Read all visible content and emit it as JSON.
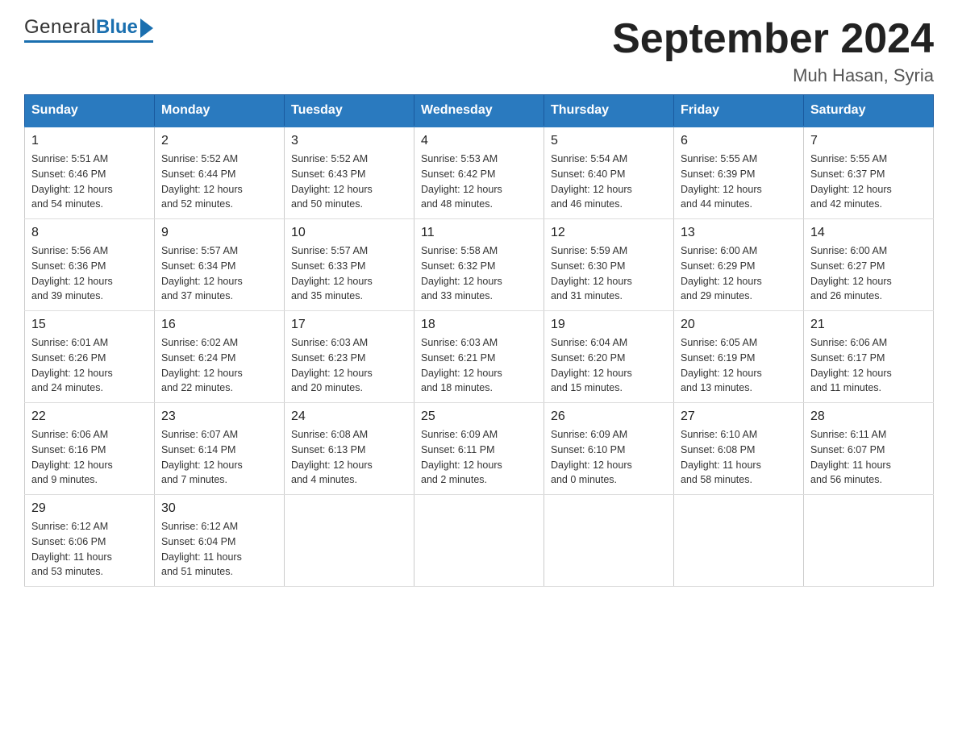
{
  "header": {
    "logo_general": "General",
    "logo_blue": "Blue",
    "month_title": "September 2024",
    "location": "Muh Hasan, Syria"
  },
  "days_of_week": [
    "Sunday",
    "Monday",
    "Tuesday",
    "Wednesday",
    "Thursday",
    "Friday",
    "Saturday"
  ],
  "weeks": [
    [
      {
        "day": "1",
        "sunrise": "5:51 AM",
        "sunset": "6:46 PM",
        "daylight": "12 hours and 54 minutes."
      },
      {
        "day": "2",
        "sunrise": "5:52 AM",
        "sunset": "6:44 PM",
        "daylight": "12 hours and 52 minutes."
      },
      {
        "day": "3",
        "sunrise": "5:52 AM",
        "sunset": "6:43 PM",
        "daylight": "12 hours and 50 minutes."
      },
      {
        "day": "4",
        "sunrise": "5:53 AM",
        "sunset": "6:42 PM",
        "daylight": "12 hours and 48 minutes."
      },
      {
        "day": "5",
        "sunrise": "5:54 AM",
        "sunset": "6:40 PM",
        "daylight": "12 hours and 46 minutes."
      },
      {
        "day": "6",
        "sunrise": "5:55 AM",
        "sunset": "6:39 PM",
        "daylight": "12 hours and 44 minutes."
      },
      {
        "day": "7",
        "sunrise": "5:55 AM",
        "sunset": "6:37 PM",
        "daylight": "12 hours and 42 minutes."
      }
    ],
    [
      {
        "day": "8",
        "sunrise": "5:56 AM",
        "sunset": "6:36 PM",
        "daylight": "12 hours and 39 minutes."
      },
      {
        "day": "9",
        "sunrise": "5:57 AM",
        "sunset": "6:34 PM",
        "daylight": "12 hours and 37 minutes."
      },
      {
        "day": "10",
        "sunrise": "5:57 AM",
        "sunset": "6:33 PM",
        "daylight": "12 hours and 35 minutes."
      },
      {
        "day": "11",
        "sunrise": "5:58 AM",
        "sunset": "6:32 PM",
        "daylight": "12 hours and 33 minutes."
      },
      {
        "day": "12",
        "sunrise": "5:59 AM",
        "sunset": "6:30 PM",
        "daylight": "12 hours and 31 minutes."
      },
      {
        "day": "13",
        "sunrise": "6:00 AM",
        "sunset": "6:29 PM",
        "daylight": "12 hours and 29 minutes."
      },
      {
        "day": "14",
        "sunrise": "6:00 AM",
        "sunset": "6:27 PM",
        "daylight": "12 hours and 26 minutes."
      }
    ],
    [
      {
        "day": "15",
        "sunrise": "6:01 AM",
        "sunset": "6:26 PM",
        "daylight": "12 hours and 24 minutes."
      },
      {
        "day": "16",
        "sunrise": "6:02 AM",
        "sunset": "6:24 PM",
        "daylight": "12 hours and 22 minutes."
      },
      {
        "day": "17",
        "sunrise": "6:03 AM",
        "sunset": "6:23 PM",
        "daylight": "12 hours and 20 minutes."
      },
      {
        "day": "18",
        "sunrise": "6:03 AM",
        "sunset": "6:21 PM",
        "daylight": "12 hours and 18 minutes."
      },
      {
        "day": "19",
        "sunrise": "6:04 AM",
        "sunset": "6:20 PM",
        "daylight": "12 hours and 15 minutes."
      },
      {
        "day": "20",
        "sunrise": "6:05 AM",
        "sunset": "6:19 PM",
        "daylight": "12 hours and 13 minutes."
      },
      {
        "day": "21",
        "sunrise": "6:06 AM",
        "sunset": "6:17 PM",
        "daylight": "12 hours and 11 minutes."
      }
    ],
    [
      {
        "day": "22",
        "sunrise": "6:06 AM",
        "sunset": "6:16 PM",
        "daylight": "12 hours and 9 minutes."
      },
      {
        "day": "23",
        "sunrise": "6:07 AM",
        "sunset": "6:14 PM",
        "daylight": "12 hours and 7 minutes."
      },
      {
        "day": "24",
        "sunrise": "6:08 AM",
        "sunset": "6:13 PM",
        "daylight": "12 hours and 4 minutes."
      },
      {
        "day": "25",
        "sunrise": "6:09 AM",
        "sunset": "6:11 PM",
        "daylight": "12 hours and 2 minutes."
      },
      {
        "day": "26",
        "sunrise": "6:09 AM",
        "sunset": "6:10 PM",
        "daylight": "12 hours and 0 minutes."
      },
      {
        "day": "27",
        "sunrise": "6:10 AM",
        "sunset": "6:08 PM",
        "daylight": "11 hours and 58 minutes."
      },
      {
        "day": "28",
        "sunrise": "6:11 AM",
        "sunset": "6:07 PM",
        "daylight": "11 hours and 56 minutes."
      }
    ],
    [
      {
        "day": "29",
        "sunrise": "6:12 AM",
        "sunset": "6:06 PM",
        "daylight": "11 hours and 53 minutes."
      },
      {
        "day": "30",
        "sunrise": "6:12 AM",
        "sunset": "6:04 PM",
        "daylight": "11 hours and 51 minutes."
      },
      null,
      null,
      null,
      null,
      null
    ]
  ],
  "labels": {
    "sunrise": "Sunrise:",
    "sunset": "Sunset:",
    "daylight": "Daylight:"
  }
}
